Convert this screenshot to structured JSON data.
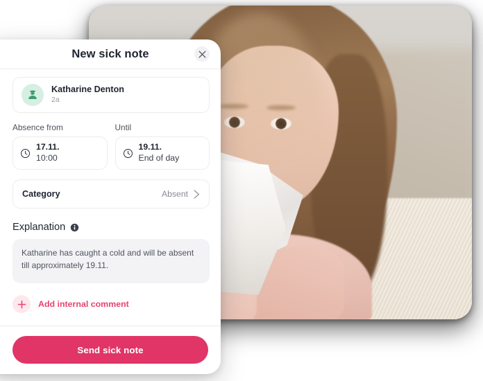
{
  "dialog": {
    "title": "New sick note",
    "close_label": "×",
    "person": {
      "name": "Katharine Denton",
      "group": "2a",
      "avatar_icon": "child-avatar-icon",
      "avatar_bg": "#d6efe2",
      "avatar_fg": "#3e9c73"
    },
    "absence_from": {
      "label": "Absence from",
      "date": "17.11.",
      "time": "10:00",
      "icon": "clock-icon"
    },
    "until": {
      "label": "Until",
      "date": "19.11.",
      "time": "End of day",
      "icon": "clock-icon"
    },
    "category": {
      "label": "Category",
      "value": "Absent",
      "chevron_icon": "chevron-right-icon"
    },
    "explanation": {
      "title": "Explanation",
      "info_icon": "info-icon",
      "text": "Katharine  has caught a cold and will be absent till approximately 19.11."
    },
    "add_comment": {
      "label": "Add internal comment",
      "icon": "plus-icon"
    },
    "submit": {
      "label": "Send sick note"
    }
  },
  "photo": {
    "alt": "Young girl with long brown hair holding a tissue to her nose, sitting on a sofa with a nasal spray bottle",
    "name": "sick-child-photo"
  },
  "colors": {
    "accent_pink": "#e03566",
    "accent_pink_soft": "#fde8ee",
    "avatar_green": "#d6efe2",
    "text_dark": "#1f2430",
    "text_muted": "#8a8a94",
    "panel_grey": "#f3f3f5",
    "border": "#ececed"
  }
}
